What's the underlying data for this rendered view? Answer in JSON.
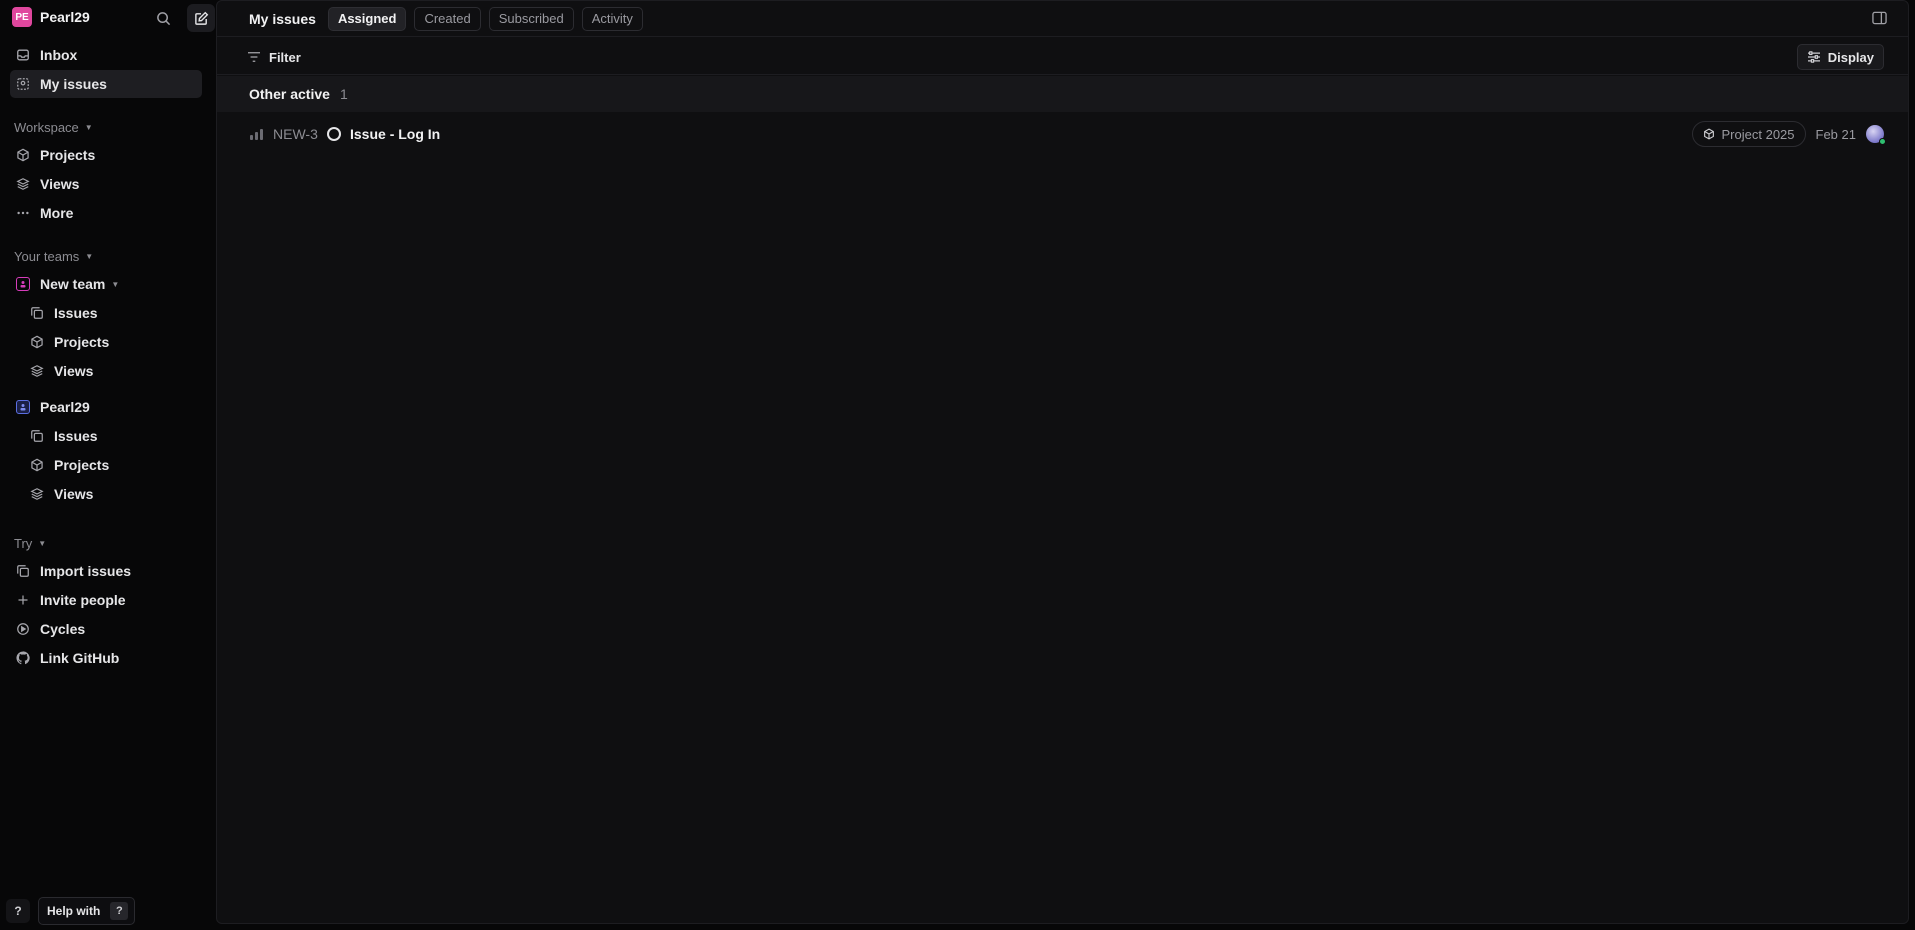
{
  "workspace": {
    "initials": "PE",
    "name": "Pearl29"
  },
  "sidebar": {
    "top_items": [
      {
        "label": "Inbox",
        "icon": "inbox-icon"
      },
      {
        "label": "My issues",
        "icon": "my-issues-icon",
        "active": true
      }
    ],
    "workspace_section": {
      "label": "Workspace",
      "items": [
        {
          "label": "Projects",
          "icon": "cube-icon"
        },
        {
          "label": "Views",
          "icon": "layers-icon"
        },
        {
          "label": "More",
          "icon": "ellipsis-icon"
        }
      ]
    },
    "teams_section": {
      "label": "Your teams",
      "teams": [
        {
          "name": "New team",
          "color": "#d63dbb",
          "items": [
            {
              "label": "Issues",
              "icon": "issues-icon"
            },
            {
              "label": "Projects",
              "icon": "cube-icon"
            },
            {
              "label": "Views",
              "icon": "layers-icon"
            }
          ]
        },
        {
          "name": "Pearl29",
          "color": "#5b6ee1",
          "items": [
            {
              "label": "Issues",
              "icon": "issues-icon"
            },
            {
              "label": "Projects",
              "icon": "cube-icon"
            },
            {
              "label": "Views",
              "icon": "layers-icon"
            }
          ]
        }
      ]
    },
    "try_section": {
      "label": "Try",
      "items": [
        {
          "label": "Import issues",
          "icon": "import-icon"
        },
        {
          "label": "Invite people",
          "icon": "plus-icon"
        },
        {
          "label": "Cycles",
          "icon": "cycles-icon"
        },
        {
          "label": "Link GitHub",
          "icon": "github-icon"
        }
      ]
    },
    "help": {
      "question": "?",
      "label": "Help with",
      "shortcut": "?"
    }
  },
  "header": {
    "title": "My issues",
    "tabs": [
      {
        "label": "Assigned",
        "active": true
      },
      {
        "label": "Created"
      },
      {
        "label": "Subscribed"
      },
      {
        "label": "Activity"
      }
    ]
  },
  "toolbar": {
    "filter_label": "Filter",
    "display_label": "Display"
  },
  "groups": [
    {
      "title": "Other active",
      "count": "1",
      "issues": [
        {
          "id": "NEW-3",
          "title": "Issue - Log In",
          "priority_bars": 3,
          "project": "Project 2025",
          "due": "Feb 21",
          "assignee_status_color": "#2fbf71"
        }
      ]
    }
  ]
}
